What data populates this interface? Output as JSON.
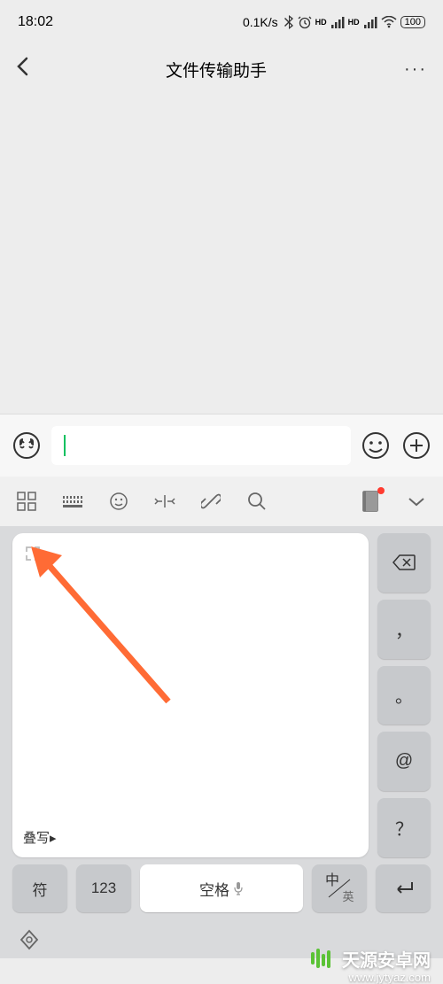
{
  "status_bar": {
    "time": "18:02",
    "speed": "0.1K/s",
    "battery": "100"
  },
  "nav": {
    "title": "文件传输助手"
  },
  "input": {
    "value": "",
    "placeholder": ""
  },
  "writing_pad": {
    "stack_label": "叠写▸"
  },
  "side_keys": {
    "comma": "，",
    "period": "。",
    "at": "@",
    "question": "？"
  },
  "bottom_keys": {
    "symbol": "符",
    "numbers": "123",
    "space": "空格",
    "lang_cn": "中",
    "lang_en": "英"
  },
  "watermark": {
    "text": "天源安卓网",
    "url": "www.jytyaz.com"
  }
}
